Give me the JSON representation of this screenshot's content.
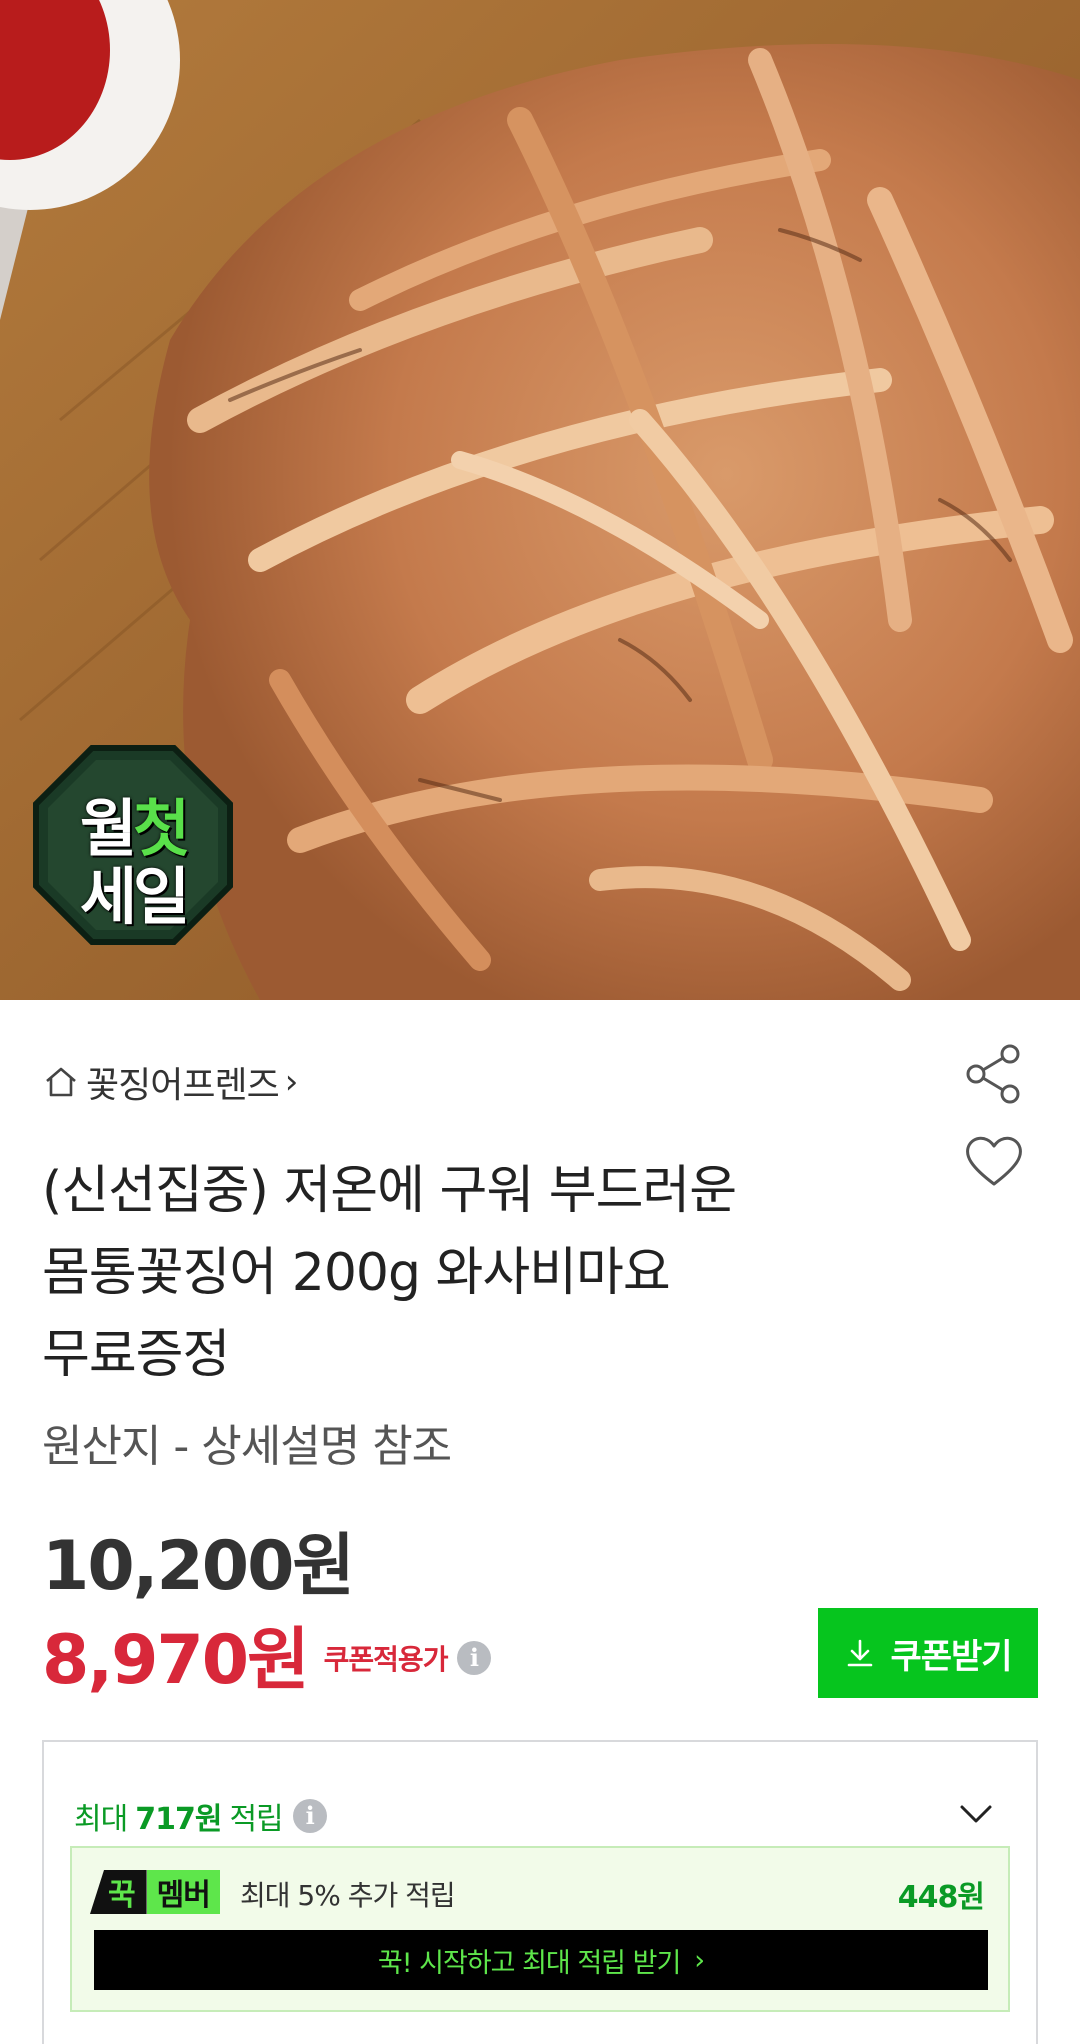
{
  "hero": {
    "badge_line1_a": "월",
    "badge_line1_b": "첫",
    "badge_line2": "세일"
  },
  "store": {
    "name": "꽃징어프렌즈",
    "chevron": "›"
  },
  "product": {
    "title_line1": "(신선집중) 저온에 구워 부드러운",
    "title_line2": "몸통꽃징어 200g 와사비마요",
    "title_line3": "무료증정",
    "origin": "원산지 - 상세설명 참조",
    "price_original": "10,200원",
    "price_sale": "8,970원",
    "price_sale_label": "쿠폰적용가",
    "info_glyph": "i"
  },
  "coupon": {
    "label": "쿠폰받기"
  },
  "points": {
    "prefix": "최대",
    "amount": "717원",
    "suffix": "적립",
    "member": {
      "logo_a": "꾹",
      "logo_b": "멤버",
      "description": "최대 5% 추가 적립",
      "amount": "448원",
      "cta": "꾹! 시작하고 최대 적립 받기",
      "cta_arrow": "›"
    }
  },
  "colors": {
    "sale_red": "#d8283a",
    "coupon_green": "#06c51e",
    "points_green": "#0a9a25",
    "member_lime": "#5ee64b"
  }
}
